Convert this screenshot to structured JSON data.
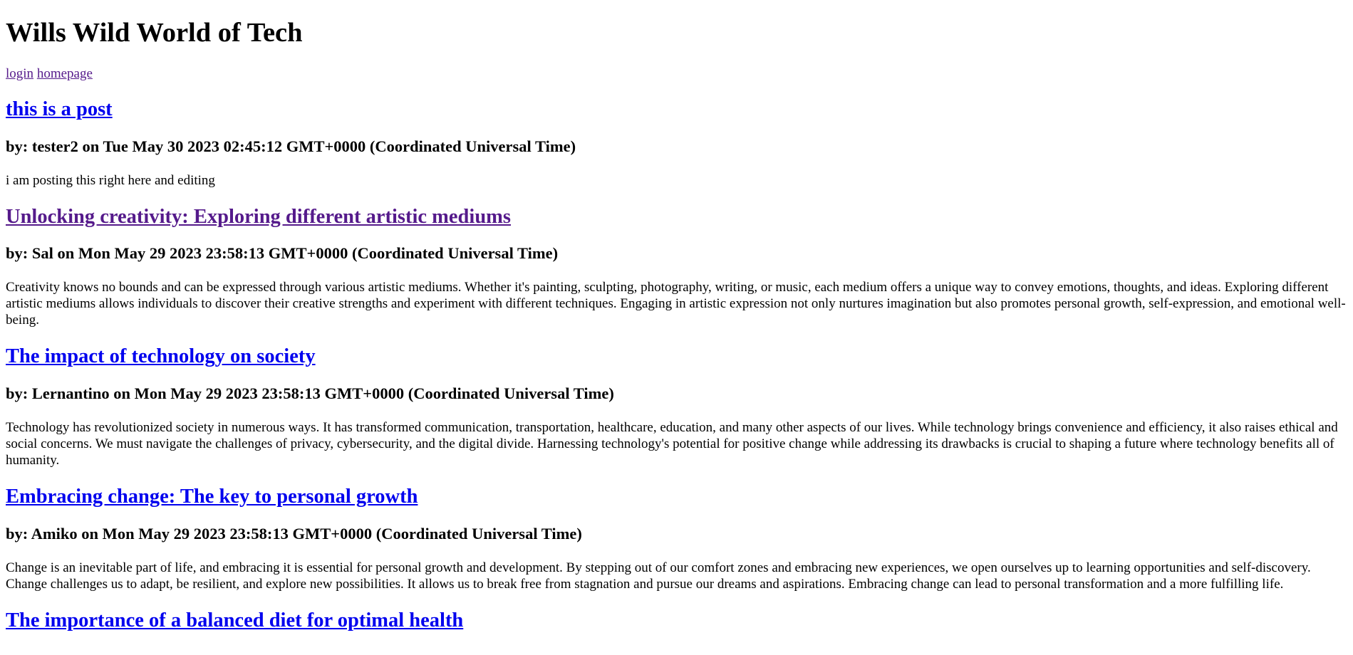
{
  "site": {
    "title": "Wills Wild World of Tech"
  },
  "nav": {
    "login_label": "login",
    "homepage_label": "homepage"
  },
  "colors": {
    "link": "#0000ee",
    "visited_link": "#551a8b",
    "text": "#000000",
    "background": "#ffffff"
  },
  "posts": [
    {
      "title": "this is a post",
      "visited": false,
      "byline": "by: tester2 on Tue May 30 2023 02:45:12 GMT+0000 (Coordinated Universal Time)",
      "body": "i am posting this right here and editing"
    },
    {
      "title": "Unlocking creativity: Exploring different artistic mediums",
      "visited": true,
      "byline": "by: Sal on Mon May 29 2023 23:58:13 GMT+0000 (Coordinated Universal Time)",
      "body": "Creativity knows no bounds and can be expressed through various artistic mediums. Whether it's painting, sculpting, photography, writing, or music, each medium offers a unique way to convey emotions, thoughts, and ideas. Exploring different artistic mediums allows individuals to discover their creative strengths and experiment with different techniques. Engaging in artistic expression not only nurtures imagination but also promotes personal growth, self-expression, and emotional well-being."
    },
    {
      "title": "The impact of technology on society",
      "visited": false,
      "byline": "by: Lernantino on Mon May 29 2023 23:58:13 GMT+0000 (Coordinated Universal Time)",
      "body": "Technology has revolutionized society in numerous ways. It has transformed communication, transportation, healthcare, education, and many other aspects of our lives. While technology brings convenience and efficiency, it also raises ethical and social concerns. We must navigate the challenges of privacy, cybersecurity, and the digital divide. Harnessing technology's potential for positive change while addressing its drawbacks is crucial to shaping a future where technology benefits all of humanity."
    },
    {
      "title": "Embracing change: The key to personal growth",
      "visited": false,
      "byline": "by: Amiko on Mon May 29 2023 23:58:13 GMT+0000 (Coordinated Universal Time)",
      "body": "Change is an inevitable part of life, and embracing it is essential for personal growth and development. By stepping out of our comfort zones and embracing new experiences, we open ourselves up to learning opportunities and self-discovery. Change challenges us to adapt, be resilient, and explore new possibilities. It allows us to break free from stagnation and pursue our dreams and aspirations. Embracing change can lead to personal transformation and a more fulfilling life."
    },
    {
      "title": "The importance of a balanced diet for optimal health",
      "visited": false,
      "byline": "",
      "body": ""
    }
  ]
}
